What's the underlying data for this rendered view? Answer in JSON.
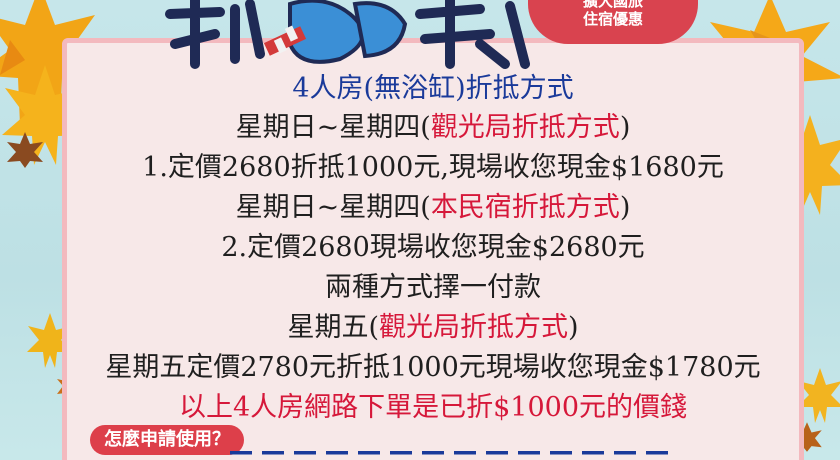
{
  "header": {
    "badge_line1": "擴大國旅",
    "badge_line2": "住宿優惠"
  },
  "content": {
    "line1": "4人房(無浴缸)折抵方式",
    "line2_prefix": "星期日~星期四(",
    "line2_red": "觀光局折抵方式",
    "line2_suffix": ")",
    "line3": "1.定價2680折抵1000元,現場收您現金$1680元",
    "line4_prefix": "星期日~星期四(",
    "line4_red": "本民宿折抵方式",
    "line4_suffix": ")",
    "line5": "2.定價2680現場收您現金$2680元",
    "line6": "兩種方式擇一付款",
    "line7_prefix": "星期五(",
    "line7_red": "觀光局折抵方式",
    "line7_suffix": ")",
    "line8": "星期五定價2780元折抵1000元現場收您現金$1780元",
    "line9": "以上4人房網路下單是已折$1000元的價錢"
  },
  "help": {
    "label": "怎麼申請使用？"
  },
  "colors": {
    "accent_red": "#d6183a",
    "blue_text": "#1a3a9a",
    "panel_border": "#f3b9be",
    "badge_red": "#d9434f"
  }
}
